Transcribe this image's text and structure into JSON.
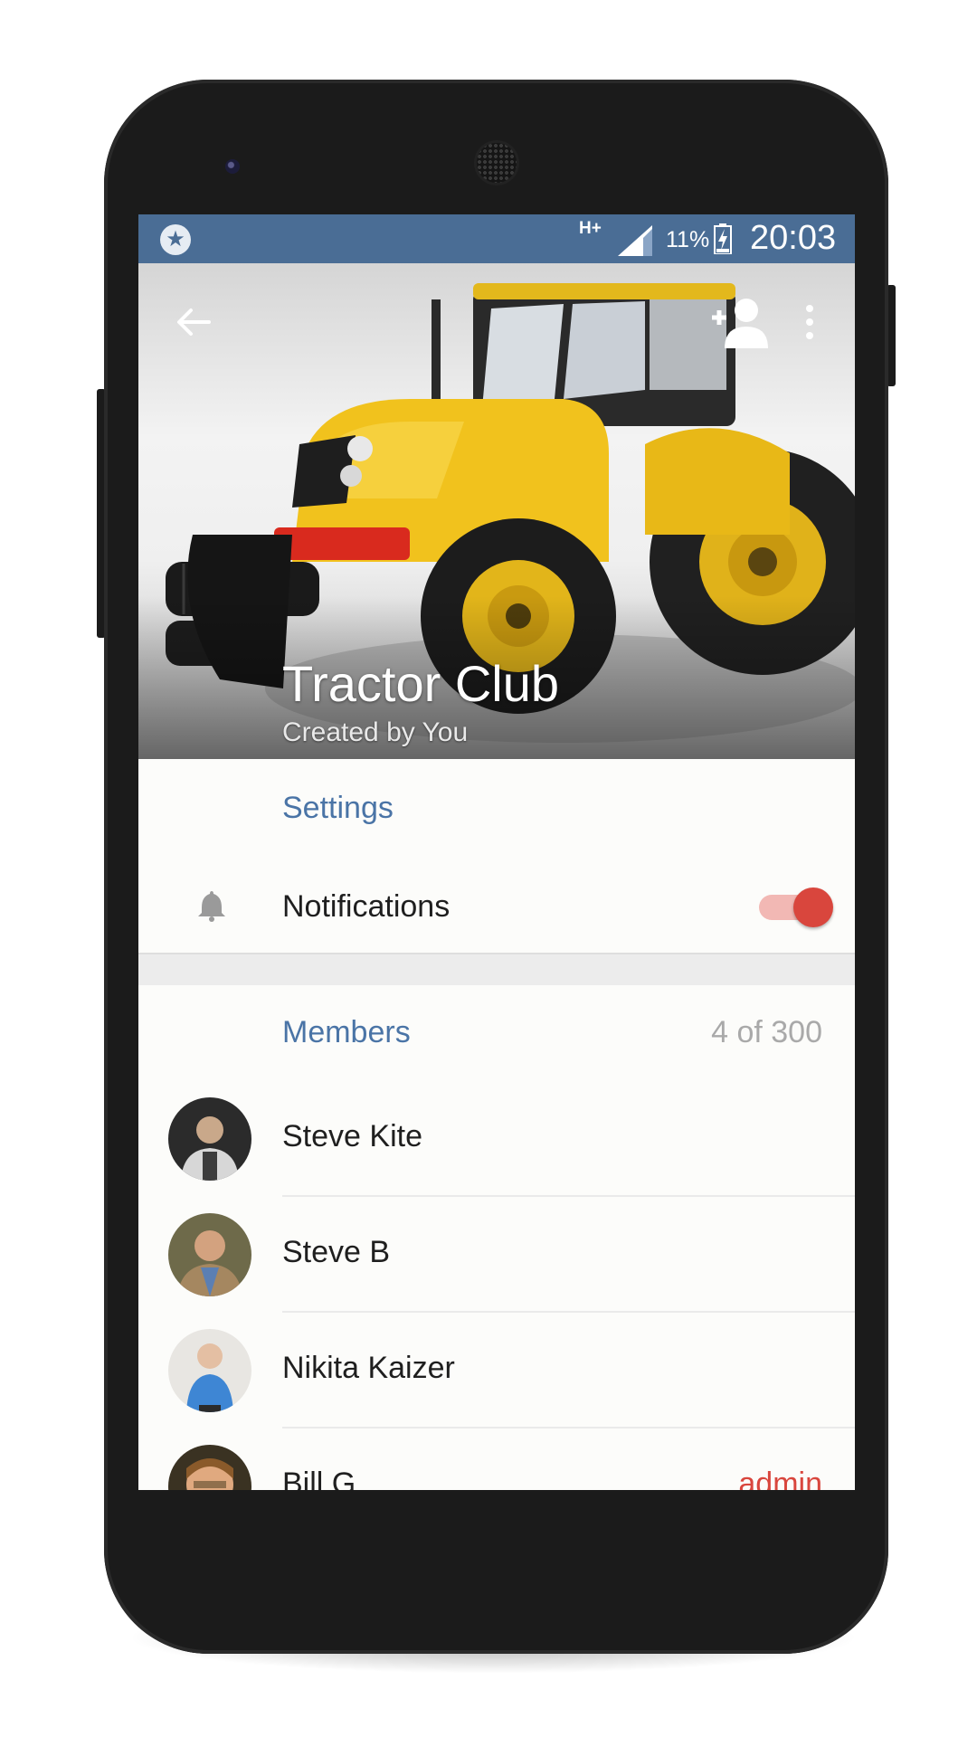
{
  "status_bar": {
    "network": "H+",
    "battery_percent": "11%",
    "time": "20:03"
  },
  "header": {
    "title": "Tractor Club",
    "subtitle": "Created by You"
  },
  "settings": {
    "heading": "Settings",
    "notifications_label": "Notifications",
    "notifications_enabled": true
  },
  "members": {
    "heading": "Members",
    "count_text": "4 of 300",
    "list": [
      {
        "name": "Steve Kite",
        "role": ""
      },
      {
        "name": "Steve B",
        "role": ""
      },
      {
        "name": "Nikita Kaizer",
        "role": ""
      },
      {
        "name": "Bill G",
        "role": "admin"
      }
    ]
  },
  "colors": {
    "accent": "#4a6d95",
    "section_heading": "#4a74a6",
    "toggle_on": "#d9463d",
    "admin_label": "#d9463d"
  },
  "icons": [
    "app-star-icon",
    "signal-icon",
    "battery-icon",
    "back-arrow-icon",
    "add-member-icon",
    "more-vert-icon",
    "bell-icon"
  ]
}
